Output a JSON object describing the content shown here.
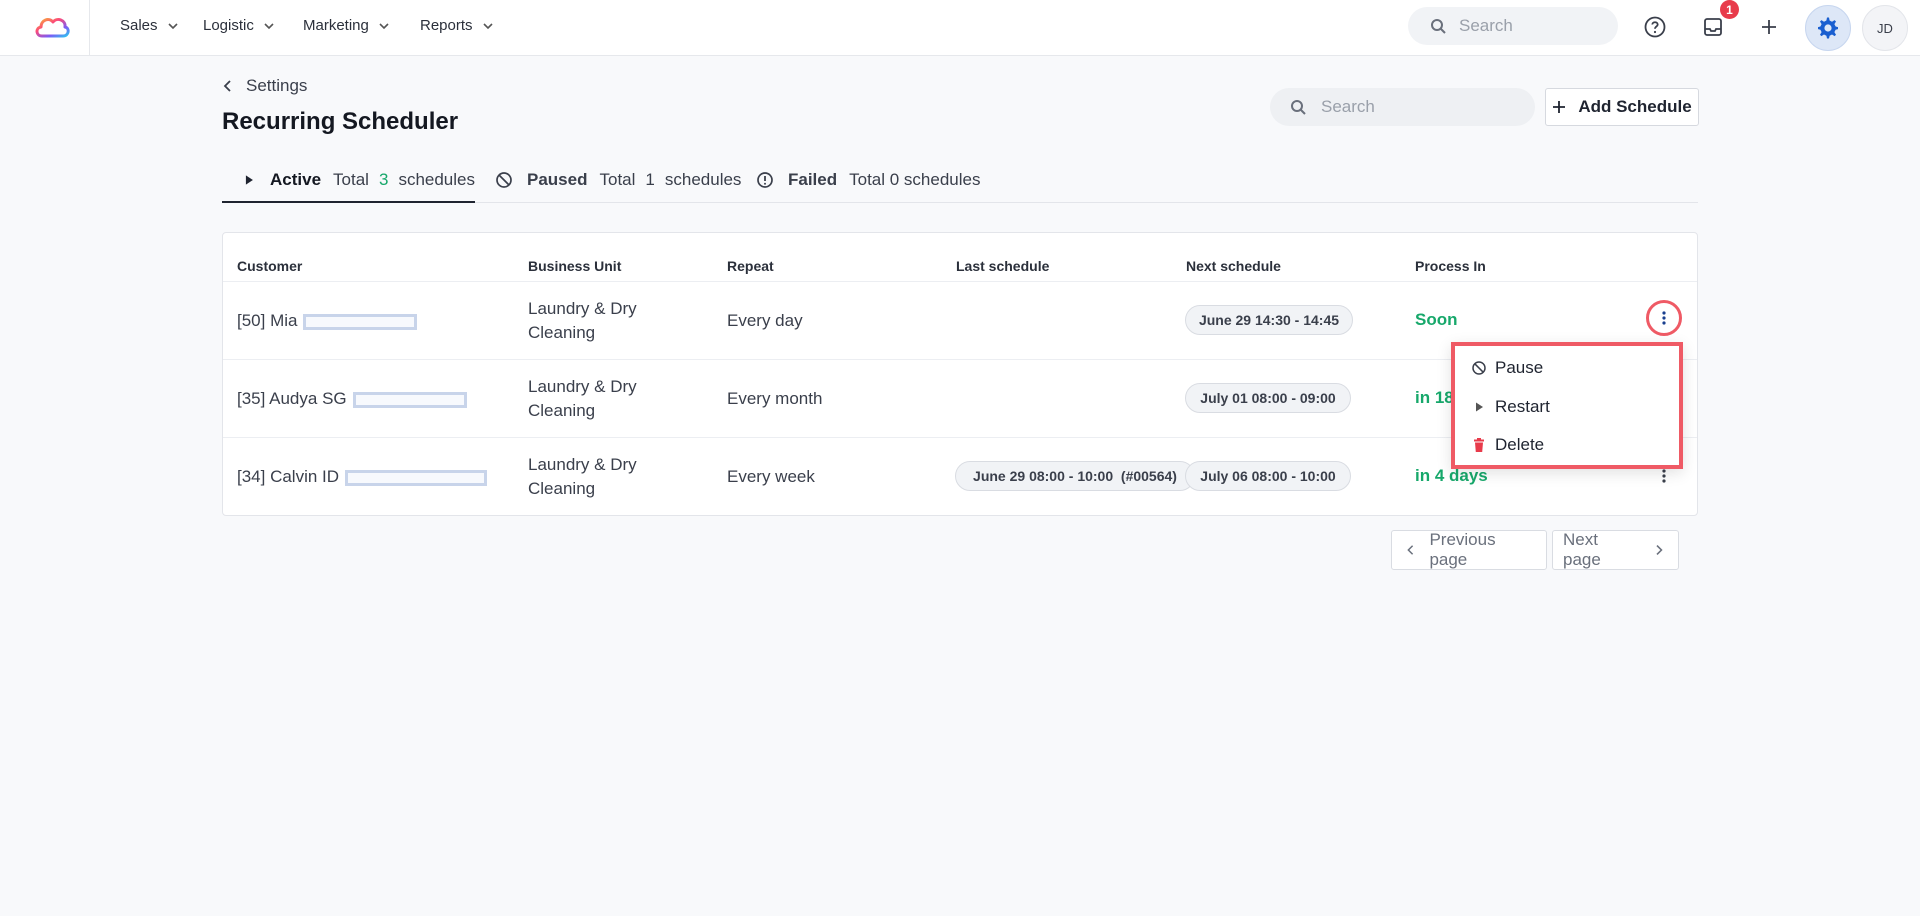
{
  "nav": {
    "items": [
      {
        "label": "Sales"
      },
      {
        "label": "Logistic"
      },
      {
        "label": "Marketing"
      },
      {
        "label": "Reports"
      }
    ],
    "search_placeholder": "Search",
    "notification_count": "1",
    "avatar_initials": "JD"
  },
  "header": {
    "back_label": "Settings",
    "title": "Recurring Scheduler",
    "search_placeholder": "Search",
    "add_button_label": "Add Schedule"
  },
  "tabs": [
    {
      "name": "Active",
      "prefix": "Total",
      "count": "3",
      "suffix": "schedules"
    },
    {
      "name": "Paused",
      "prefix": "Total",
      "count": "1",
      "suffix": "schedules"
    },
    {
      "name": "Failed",
      "text": "Total 0 schedules"
    }
  ],
  "table": {
    "columns": [
      "Customer",
      "Business Unit",
      "Repeat",
      "Last schedule",
      "Next schedule",
      "Process In"
    ],
    "rows": [
      {
        "customer": "[50] Mia",
        "business_unit_line1": "Laundry & Dry",
        "business_unit_line2": "Cleaning",
        "repeat": "Every day",
        "last_schedule": "",
        "next_schedule": "June 29 14:30 - 14:45",
        "process_in": "Soon"
      },
      {
        "customer": "[35] Audya SG",
        "business_unit_line1": "Laundry & Dry",
        "business_unit_line2": "Cleaning",
        "repeat": "Every month",
        "last_schedule": "",
        "next_schedule": "July 01 08:00 - 09:00",
        "process_in": "in 18"
      },
      {
        "customer": "[34] Calvin ID",
        "business_unit_line1": "Laundry & Dry",
        "business_unit_line2": "Cleaning",
        "repeat": "Every week",
        "last_schedule": "June 29 08:00 - 10:00  (#00564)",
        "next_schedule": "July 06 08:00 - 10:00",
        "process_in": "in 4 days"
      }
    ]
  },
  "row_menu": {
    "pause_label": "Pause",
    "restart_label": "Restart",
    "delete_label": "Delete"
  },
  "pagination": {
    "previous_label": "Previous page",
    "next_label": "Next page"
  },
  "colors": {
    "accent_green": "#17a86b",
    "highlight_red": "#ef5a65",
    "delete_red": "#e83b4b",
    "gear_blue": "#1a5fd0"
  }
}
